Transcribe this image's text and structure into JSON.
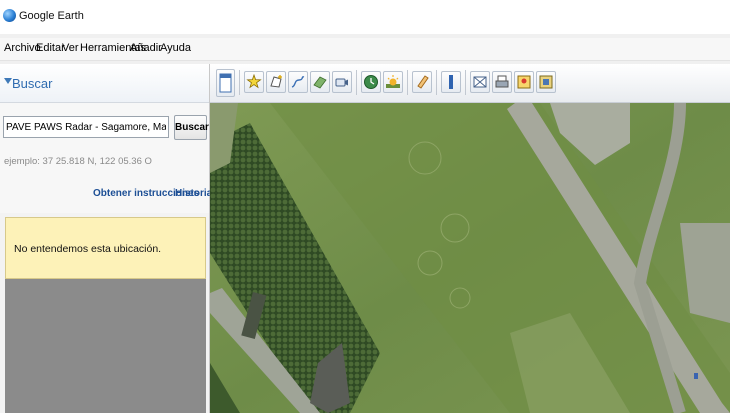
{
  "window": {
    "title": "Google Earth"
  },
  "menu": [
    "Archivo",
    "Editar",
    "Ver",
    "Herramientas",
    "Añadir",
    "Ayuda"
  ],
  "search": {
    "panel_title": "Buscar",
    "input_value": "PAVE PAWS Radar - Sagamore, Massachusetts",
    "button_label": "Buscar",
    "example_text": "ejemplo: 37 25.818 N, 122 05.36 O",
    "directions_link": "Obtener instrucciones",
    "history_link": "Historial",
    "error_message": "No entendemos esta ubicación."
  },
  "toolbar": {
    "tools": [
      "sidebar-toggle-icon",
      "placemark-icon",
      "polygon-icon",
      "path-icon",
      "image-overlay-icon",
      "record-tour-icon",
      "historical-imagery-icon",
      "sunlight-icon",
      "planets-icon",
      "ruler-icon",
      "email-icon",
      "print-icon",
      "google-maps-icon",
      "export-icon"
    ]
  },
  "colors": {
    "accent": "#2f6bb0",
    "link": "#1d4f95",
    "error_bg": "#fdf2b8",
    "map_grass": "#6f8a4c"
  }
}
